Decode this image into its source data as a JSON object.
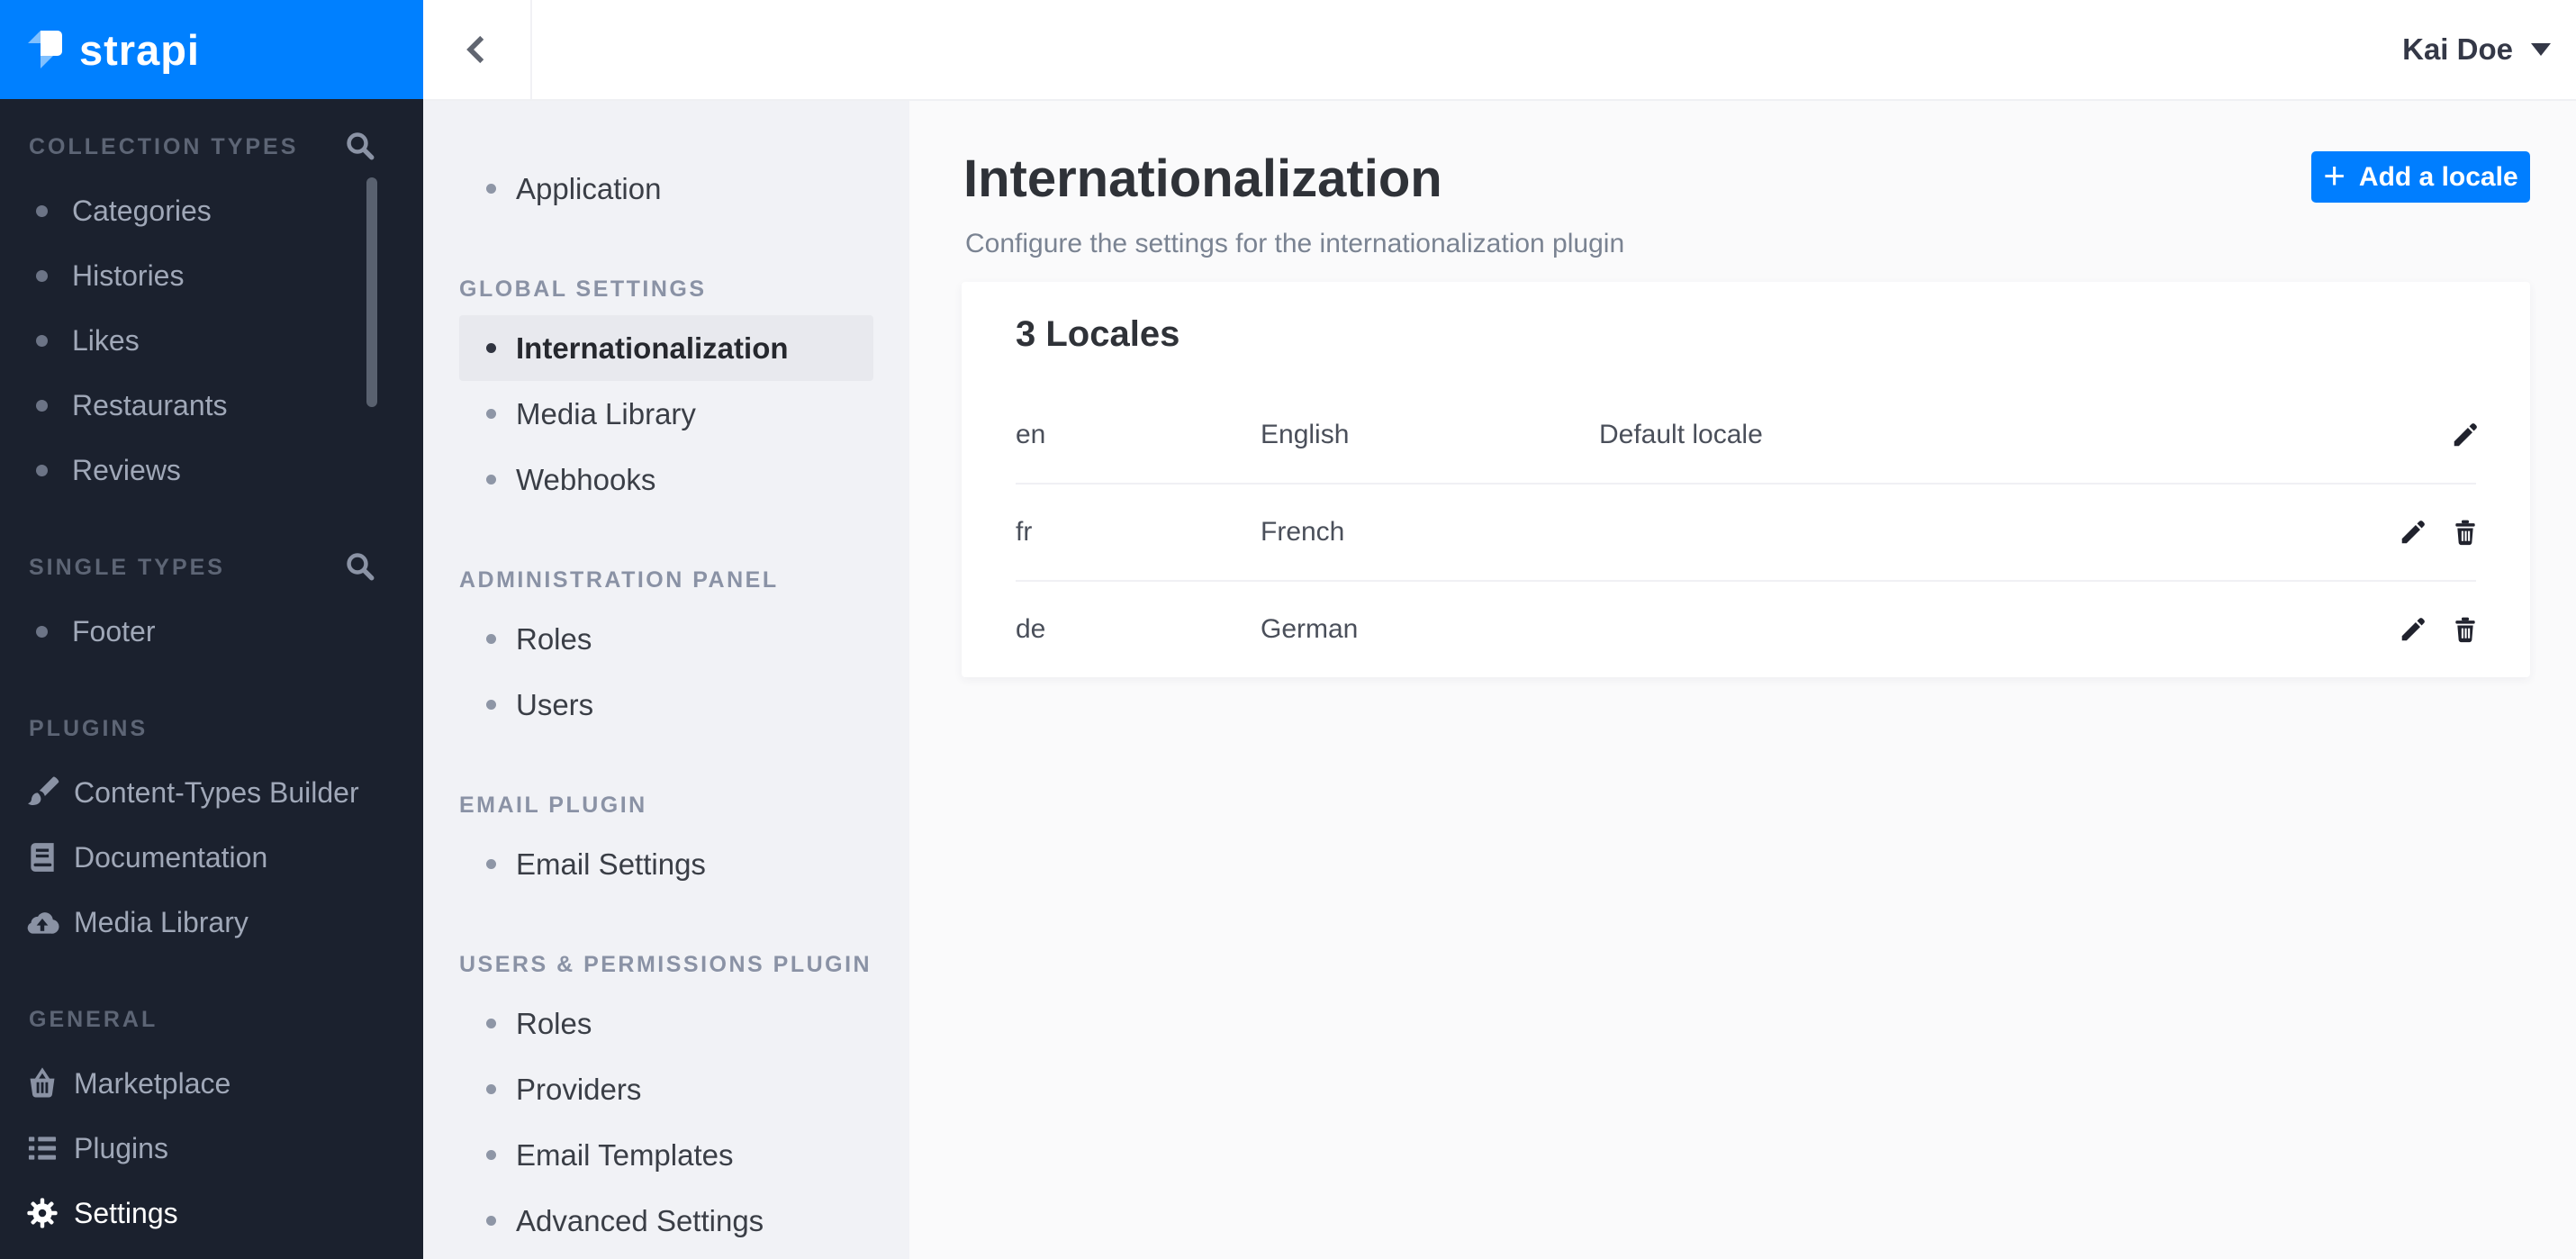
{
  "brand": {
    "logo_text": "strapi"
  },
  "colors": {
    "brand_blue": "#0080ff",
    "button_blue": "#007eff",
    "sidebar_bg": "#1b212e",
    "subnav_bg": "#f1f2f6",
    "main_bg": "#fafafb",
    "active_item_bg": "#e8e9ee",
    "text_dark": "#2f3238",
    "text_gray": "#7a8392"
  },
  "left_nav": {
    "sections": [
      {
        "label": "COLLECTION TYPES",
        "search_icon": "search-icon",
        "items": [
          {
            "label": "Categories"
          },
          {
            "label": "Histories"
          },
          {
            "label": "Likes"
          },
          {
            "label": "Restaurants"
          },
          {
            "label": "Reviews"
          }
        ]
      },
      {
        "label": "SINGLE TYPES",
        "search_icon": "search-icon",
        "items": [
          {
            "label": "Footer"
          }
        ]
      },
      {
        "label": "PLUGINS",
        "items": [
          {
            "label": "Content-Types Builder",
            "icon": "brush-icon"
          },
          {
            "label": "Documentation",
            "icon": "book-icon"
          },
          {
            "label": "Media Library",
            "icon": "cloud-upload-icon"
          }
        ]
      },
      {
        "label": "GENERAL",
        "items": [
          {
            "label": "Marketplace",
            "icon": "basket-icon"
          },
          {
            "label": "Plugins",
            "icon": "list-icon"
          },
          {
            "label": "Settings",
            "icon": "gear-icon",
            "active": true
          }
        ]
      }
    ]
  },
  "topbar": {
    "back_icon": "chevron-left-icon",
    "user_name": "Kai Doe",
    "caret_icon": "caret-down-icon"
  },
  "settings_nav": {
    "groups": [
      {
        "header": "",
        "items": [
          {
            "label": "Application"
          }
        ]
      },
      {
        "header": "GLOBAL SETTINGS",
        "items": [
          {
            "label": "Internationalization",
            "active": true
          },
          {
            "label": "Media Library"
          },
          {
            "label": "Webhooks"
          }
        ]
      },
      {
        "header": "ADMINISTRATION PANEL",
        "items": [
          {
            "label": "Roles"
          },
          {
            "label": "Users"
          }
        ]
      },
      {
        "header": "EMAIL PLUGIN",
        "items": [
          {
            "label": "Email Settings"
          }
        ]
      },
      {
        "header": "USERS & PERMISSIONS PLUGIN",
        "items": [
          {
            "label": "Roles"
          },
          {
            "label": "Providers"
          },
          {
            "label": "Email Templates"
          },
          {
            "label": "Advanced Settings"
          }
        ]
      }
    ]
  },
  "main": {
    "title": "Internationalization",
    "subtitle": "Configure the settings for the internationalization plugin",
    "add_button": {
      "plus": "+",
      "label": "Add a locale"
    },
    "card": {
      "title": "3 Locales",
      "rows": [
        {
          "code": "en",
          "name": "English",
          "status": "Default locale",
          "actions": [
            "edit-icon"
          ]
        },
        {
          "code": "fr",
          "name": "French",
          "status": "",
          "actions": [
            "edit-icon",
            "delete-icon"
          ]
        },
        {
          "code": "de",
          "name": "German",
          "status": "",
          "actions": [
            "edit-icon",
            "delete-icon"
          ]
        }
      ]
    }
  }
}
